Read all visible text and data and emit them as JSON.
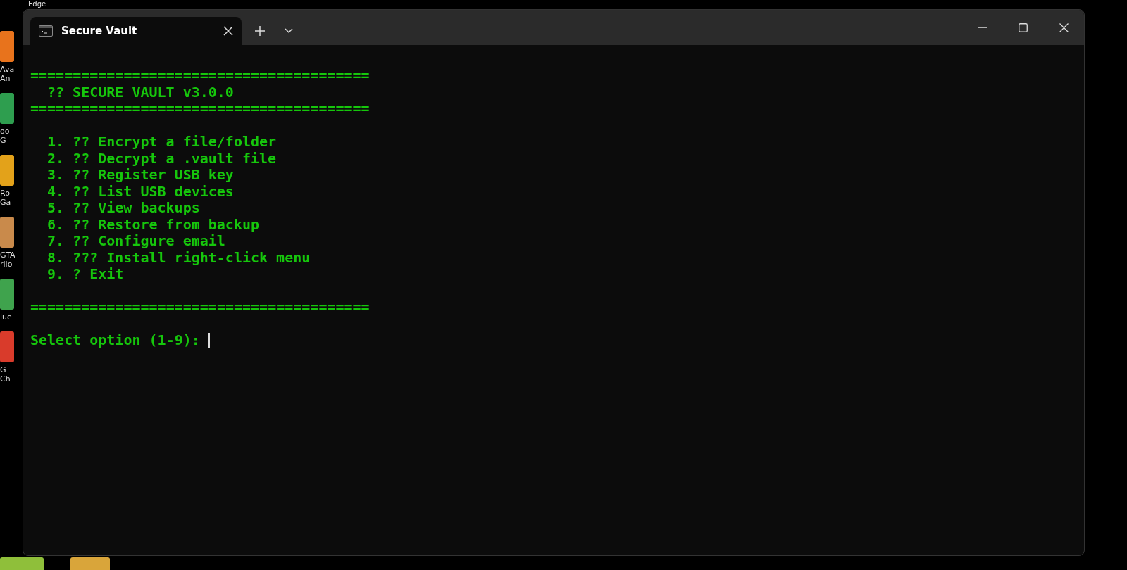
{
  "desktop": {
    "top_label": "Edge",
    "icons": [
      {
        "lines": [
          "Ava",
          "An"
        ],
        "color": "#e8731c"
      },
      {
        "lines": [
          "oo",
          "G"
        ],
        "color": "#2e9e4f"
      },
      {
        "lines": [
          "Ro",
          "Ga"
        ],
        "color": "#e3a21a"
      },
      {
        "lines": [
          "GTA",
          "rilo"
        ],
        "color": "#c98a4b"
      },
      {
        "lines": [
          "lue"
        ],
        "color": "#3fa34d"
      },
      {
        "lines": [
          "G",
          "Ch"
        ],
        "color": "#d93b2b"
      }
    ]
  },
  "window": {
    "tab": {
      "title": "Secure Vault",
      "selected": true
    }
  },
  "terminal": {
    "rule_top": "========================================",
    "title": "?? SECURE VAULT v3.0.0",
    "rule_bottom": "========================================",
    "menu": [
      "1. ?? Encrypt a file/folder",
      "2. ?? Decrypt a .vault file",
      "3. ?? Register USB key",
      "4. ?? List USB devices",
      "5. ?? View backups",
      "6. ?? Restore from backup",
      "7. ?? Configure email",
      "8. ??? Install right-click menu",
      "9. ? Exit"
    ],
    "footer_rule": "========================================",
    "prompt": {
      "text": "Select option (1-9):",
      "cursor": true
    }
  }
}
